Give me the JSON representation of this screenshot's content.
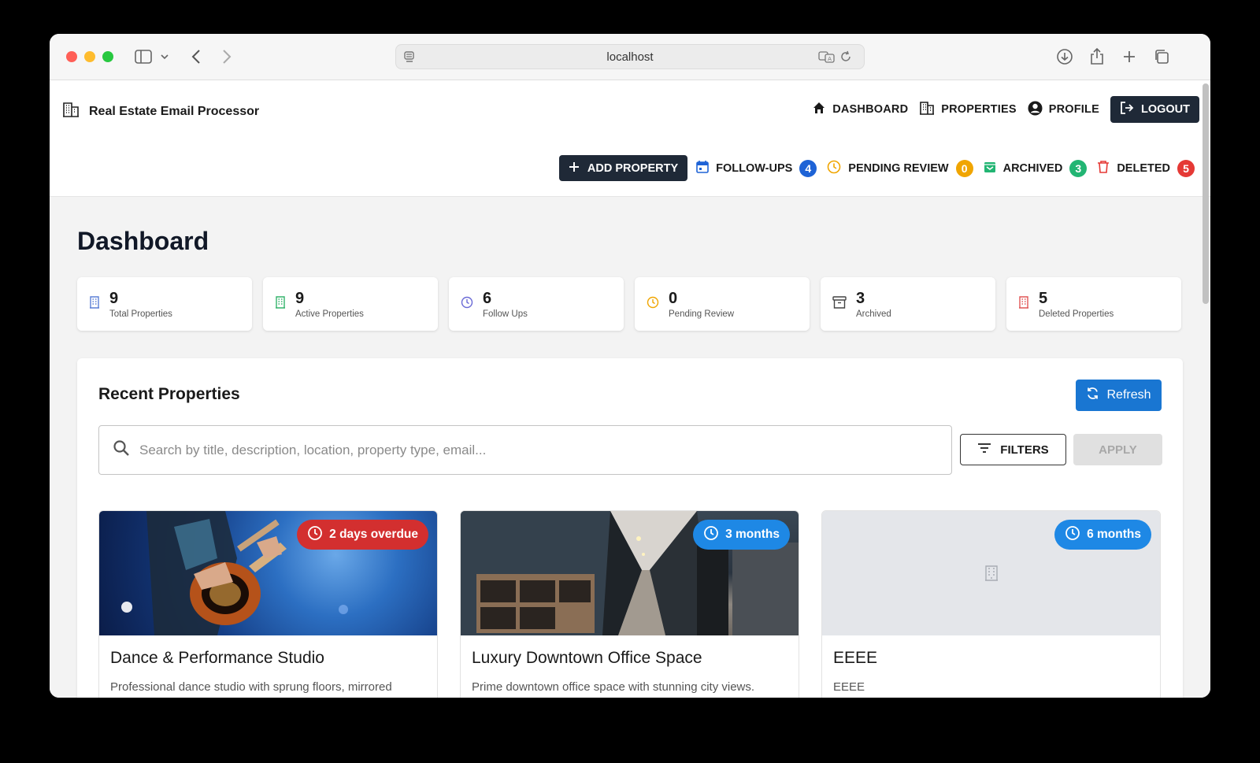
{
  "browser": {
    "url": "localhost"
  },
  "app": {
    "brand": "Real Estate Email Processor",
    "nav": [
      {
        "label": "DASHBOARD",
        "icon": "home-icon"
      },
      {
        "label": "PROPERTIES",
        "icon": "building-icon"
      },
      {
        "label": "PROFILE",
        "icon": "account-icon"
      }
    ],
    "logout_label": "LOGOUT"
  },
  "subnav": {
    "add_label": "ADD PROPERTY",
    "items": [
      {
        "label": "FOLLOW-UPS",
        "count": "4",
        "color": "#1e63d6"
      },
      {
        "label": "PENDING REVIEW",
        "count": "0",
        "color": "#f0a500"
      },
      {
        "label": "ARCHIVED",
        "count": "3",
        "color": "#22b573"
      },
      {
        "label": "DELETED",
        "count": "5",
        "color": "#e53935"
      }
    ]
  },
  "dashboard": {
    "title": "Dashboard",
    "stats": [
      {
        "value": "9",
        "label": "Total Properties",
        "color": "#5b7fd6"
      },
      {
        "value": "9",
        "label": "Active Properties",
        "color": "#34b36b"
      },
      {
        "value": "6",
        "label": "Follow Ups",
        "color": "#6b6bd6"
      },
      {
        "value": "0",
        "label": "Pending Review",
        "color": "#f0a500"
      },
      {
        "value": "3",
        "label": "Archived",
        "color": "#444444"
      },
      {
        "value": "5",
        "label": "Deleted Properties",
        "color": "#e05555"
      }
    ]
  },
  "recent": {
    "title": "Recent Properties",
    "refresh_label": "Refresh",
    "search_placeholder": "Search by title, description, location, property type, email...",
    "filters_label": "FILTERS",
    "apply_label": "APPLY",
    "cards": [
      {
        "title": "Dance & Performance Studio",
        "desc": "Professional dance studio with sprung floors, mirrored",
        "badge": "2 days overdue",
        "badge_color": "#d32f2f"
      },
      {
        "title": "Luxury Downtown Office Space",
        "desc": "Prime downtown office space with stunning city views.",
        "badge": "3 months",
        "badge_color": "#1e88e5"
      },
      {
        "title": "EEEE",
        "desc": "EEEE",
        "badge": "6 months",
        "badge_color": "#1e88e5"
      }
    ]
  }
}
